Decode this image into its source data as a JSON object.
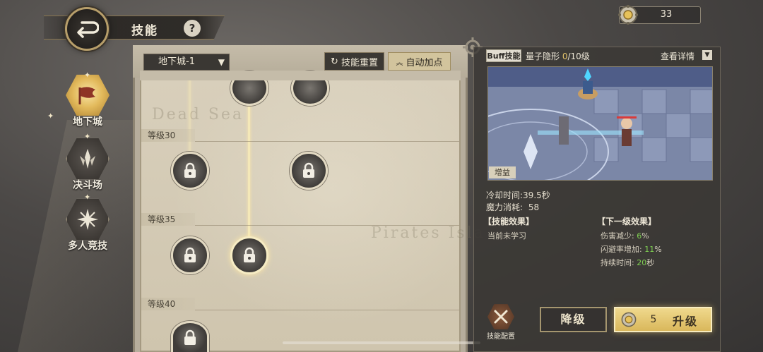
{
  "header": {
    "title": "技能",
    "help": "?"
  },
  "currency": {
    "icon": "gear-coin-icon",
    "amount": "33"
  },
  "nav": {
    "items": [
      {
        "label": "地下城",
        "icon": "flag-icon",
        "active": true
      },
      {
        "label": "决斗场",
        "icon": "crystal-icon",
        "active": false
      },
      {
        "label": "多人竞技",
        "icon": "star-burst-icon",
        "active": false
      }
    ]
  },
  "tree": {
    "dungeon_select": "地下城-1",
    "reset_label": "技能重置",
    "auto_label": "自动加点",
    "watermark_left": "Dead Sea",
    "watermark_right": "Pirates Isla",
    "levels": [
      "等级30",
      "等级35",
      "等级40"
    ]
  },
  "detail": {
    "type_badge": "Buff技能",
    "skill_name": "量子隐形",
    "level_current": "0",
    "level_max": "/10级",
    "view_detail": "查看详情",
    "buff_tag": "增益",
    "cooldown_label": "冷却时间:",
    "cooldown_value": "39.5秒",
    "mana_label": "魔力消耗:",
    "mana_value": "58",
    "effect_title": "【技能效果】",
    "effect_note": "当前未学习",
    "next_title": "【下一级效果】",
    "next_effects": [
      {
        "label": "伤害减少:",
        "value": "6",
        "unit": "%"
      },
      {
        "label": "闪避率增加:",
        "value": "11",
        "unit": "%"
      },
      {
        "label": "持续时间:",
        "value": "20",
        "unit": "秒"
      }
    ],
    "config_label": "技能配置",
    "downgrade_label": "降级",
    "upgrade_cost": "5",
    "upgrade_label": "升级"
  },
  "colors": {
    "accent_gold": "#e3c36b",
    "value_green": "#7fcf52",
    "panel_dark": "#3a3835"
  }
}
